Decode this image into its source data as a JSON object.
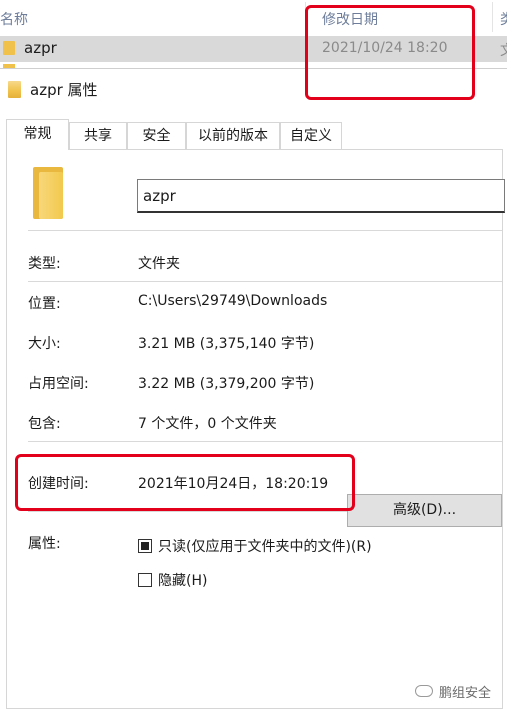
{
  "explorer": {
    "columns": {
      "name": "名称",
      "date_modified": "修改日期",
      "more": "类"
    },
    "selected_file": {
      "name": "azpr",
      "date_modified": "2021/10/24 18:20",
      "more": "文"
    }
  },
  "dialog": {
    "title": "azpr 属性",
    "tabs": [
      "常规",
      "共享",
      "安全",
      "以前的版本",
      "自定义"
    ],
    "active_tab": "常规",
    "name_value": "azpr",
    "properties": {
      "type": {
        "label": "类型:",
        "value": "文件夹"
      },
      "location": {
        "label": "位置:",
        "value": "C:\\Users\\29749\\Downloads"
      },
      "size": {
        "label": "大小:",
        "value": "3.21 MB (3,375,140 字节)"
      },
      "size_on_disk": {
        "label": "占用空间:",
        "value": "3.22 MB (3,379,200 字节)"
      },
      "contains": {
        "label": "包含:",
        "value": "7 个文件，0 个文件夹"
      },
      "created": {
        "label": "创建时间:",
        "value": "2021年10月24日，18:20:19"
      }
    },
    "attributes": {
      "label": "属性:",
      "readonly_label": "只读(仅应用于文件夹中的文件)(R)",
      "readonly_state": "indeterminate",
      "hidden_label": "隐藏(H)",
      "hidden_checked": false,
      "advanced_button": "高级(D)..."
    }
  },
  "watermark": {
    "text": "鹏组安全"
  },
  "colors": {
    "highlight_box": "#e3001b",
    "folder": "#f0c14b"
  }
}
